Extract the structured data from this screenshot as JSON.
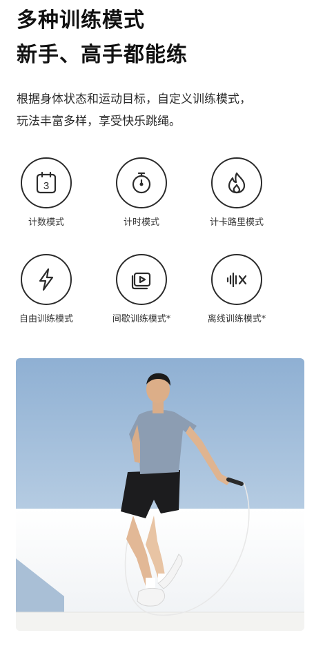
{
  "headline": {
    "line1": "多种训练模式",
    "line2": "新手、高手都能练"
  },
  "description": {
    "line1": "根据身体状态和运动目标，自定义训练模式，",
    "line2": "玩法丰富多样，享受快乐跳绳。"
  },
  "modes": [
    {
      "icon": "calendar-icon",
      "icon_text": "3",
      "label": "计数模式"
    },
    {
      "icon": "stopwatch-icon",
      "label": "计时模式"
    },
    {
      "icon": "flame-icon",
      "label": "计卡路里模式"
    },
    {
      "icon": "lightning-icon",
      "label": "自由训练模式"
    },
    {
      "icon": "interval-video-icon",
      "label": "间歇训练模式*"
    },
    {
      "icon": "offline-sound-icon",
      "label": "离线训练模式*"
    }
  ],
  "photo": {
    "subject": "man-jumping-rope-photo"
  }
}
